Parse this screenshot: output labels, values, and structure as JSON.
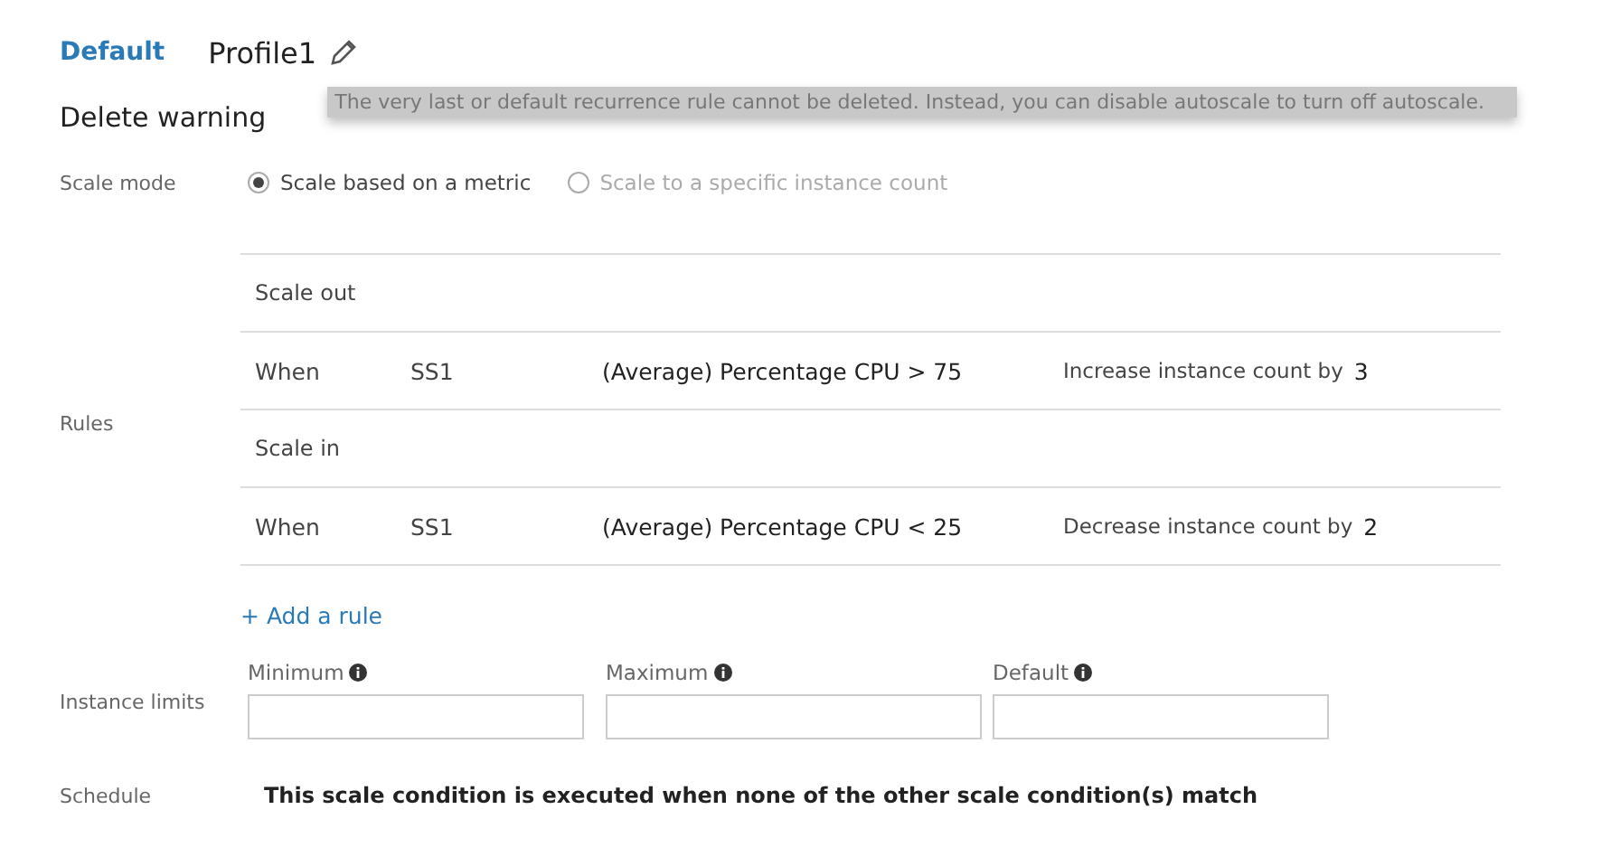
{
  "header": {
    "badge": "Default",
    "profile_name": "Profile1"
  },
  "delete_warning": {
    "label": "Delete warning",
    "message": "The very last or default recurrence rule cannot be deleted. Instead, you can disable autoscale to turn off autoscale."
  },
  "scale_mode": {
    "label": "Scale mode",
    "options": [
      {
        "label": "Scale based on a metric",
        "selected": true
      },
      {
        "label": "Scale to a specific instance count",
        "selected": false
      }
    ]
  },
  "rules": {
    "label": "Rules",
    "rows": [
      {
        "kind": "section",
        "title": "Scale out"
      },
      {
        "kind": "rule",
        "when": "When",
        "resource": "SS1",
        "condition": "(Average) Percentage CPU > 75",
        "action": "Increase instance count by",
        "count": "3"
      },
      {
        "kind": "section",
        "title": "Scale in"
      },
      {
        "kind": "rule",
        "when": "When",
        "resource": "SS1",
        "condition": "(Average) Percentage CPU < 25",
        "action": "Decrease instance count by",
        "count": "2"
      }
    ],
    "add_link": "+ Add a rule"
  },
  "instance_limits": {
    "label": "Instance limits",
    "fields": [
      {
        "label": "Minimum"
      },
      {
        "label": "Maximum"
      },
      {
        "label": "Default"
      }
    ]
  },
  "schedule": {
    "label": "Schedule",
    "text": "This scale condition is executed when none of the other scale condition(s) match"
  }
}
